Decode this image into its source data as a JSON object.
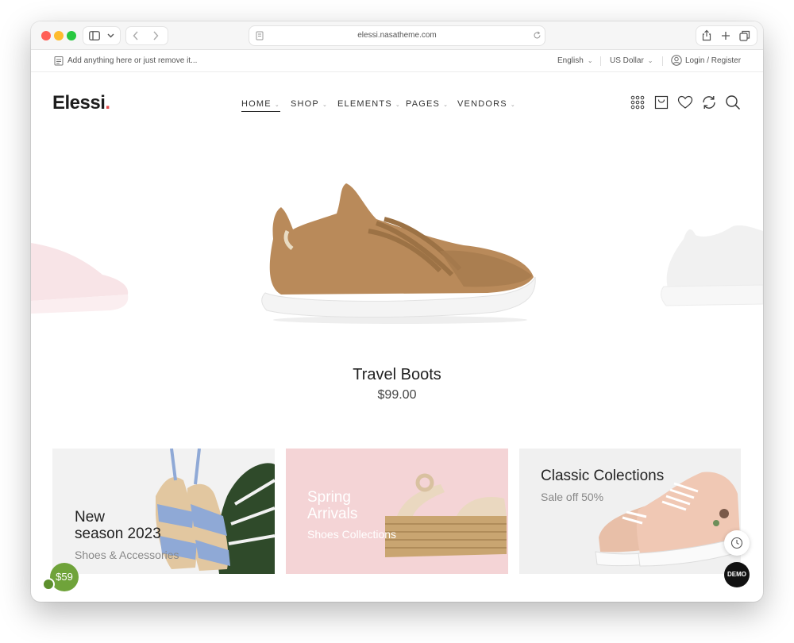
{
  "browser": {
    "url": "elessi.nasatheme.com"
  },
  "topbar": {
    "message": "Add anything here or just remove it...",
    "language": "English",
    "currency": "US Dollar",
    "login": "Login / Register"
  },
  "header": {
    "logo_text": "Elessi",
    "logo_dot": ".",
    "menu": [
      {
        "label": "HOME"
      },
      {
        "label": "SHOP"
      },
      {
        "label": "ELEMENTS"
      },
      {
        "label": "PAGES"
      },
      {
        "label": "VENDORS"
      }
    ]
  },
  "hero": {
    "product_title": "Travel Boots",
    "product_price": "$99.00"
  },
  "banners": [
    {
      "title_line1": "New",
      "title_line2": "season 2023",
      "subtitle": "Shoes & Accessories"
    },
    {
      "title_line1": "Spring",
      "title_line2": "Arrivals",
      "subtitle": "Shoes Collections"
    },
    {
      "title_line1": "Classic Colections",
      "subtitle": "Sale off 50%"
    }
  ],
  "floating": {
    "demo_label": "DEMO",
    "price_badge": "$59"
  },
  "colors": {
    "logo_dot": "#e24a4a",
    "banner_pink": "#f4d4d6",
    "price_badge": "#6fa33a"
  }
}
